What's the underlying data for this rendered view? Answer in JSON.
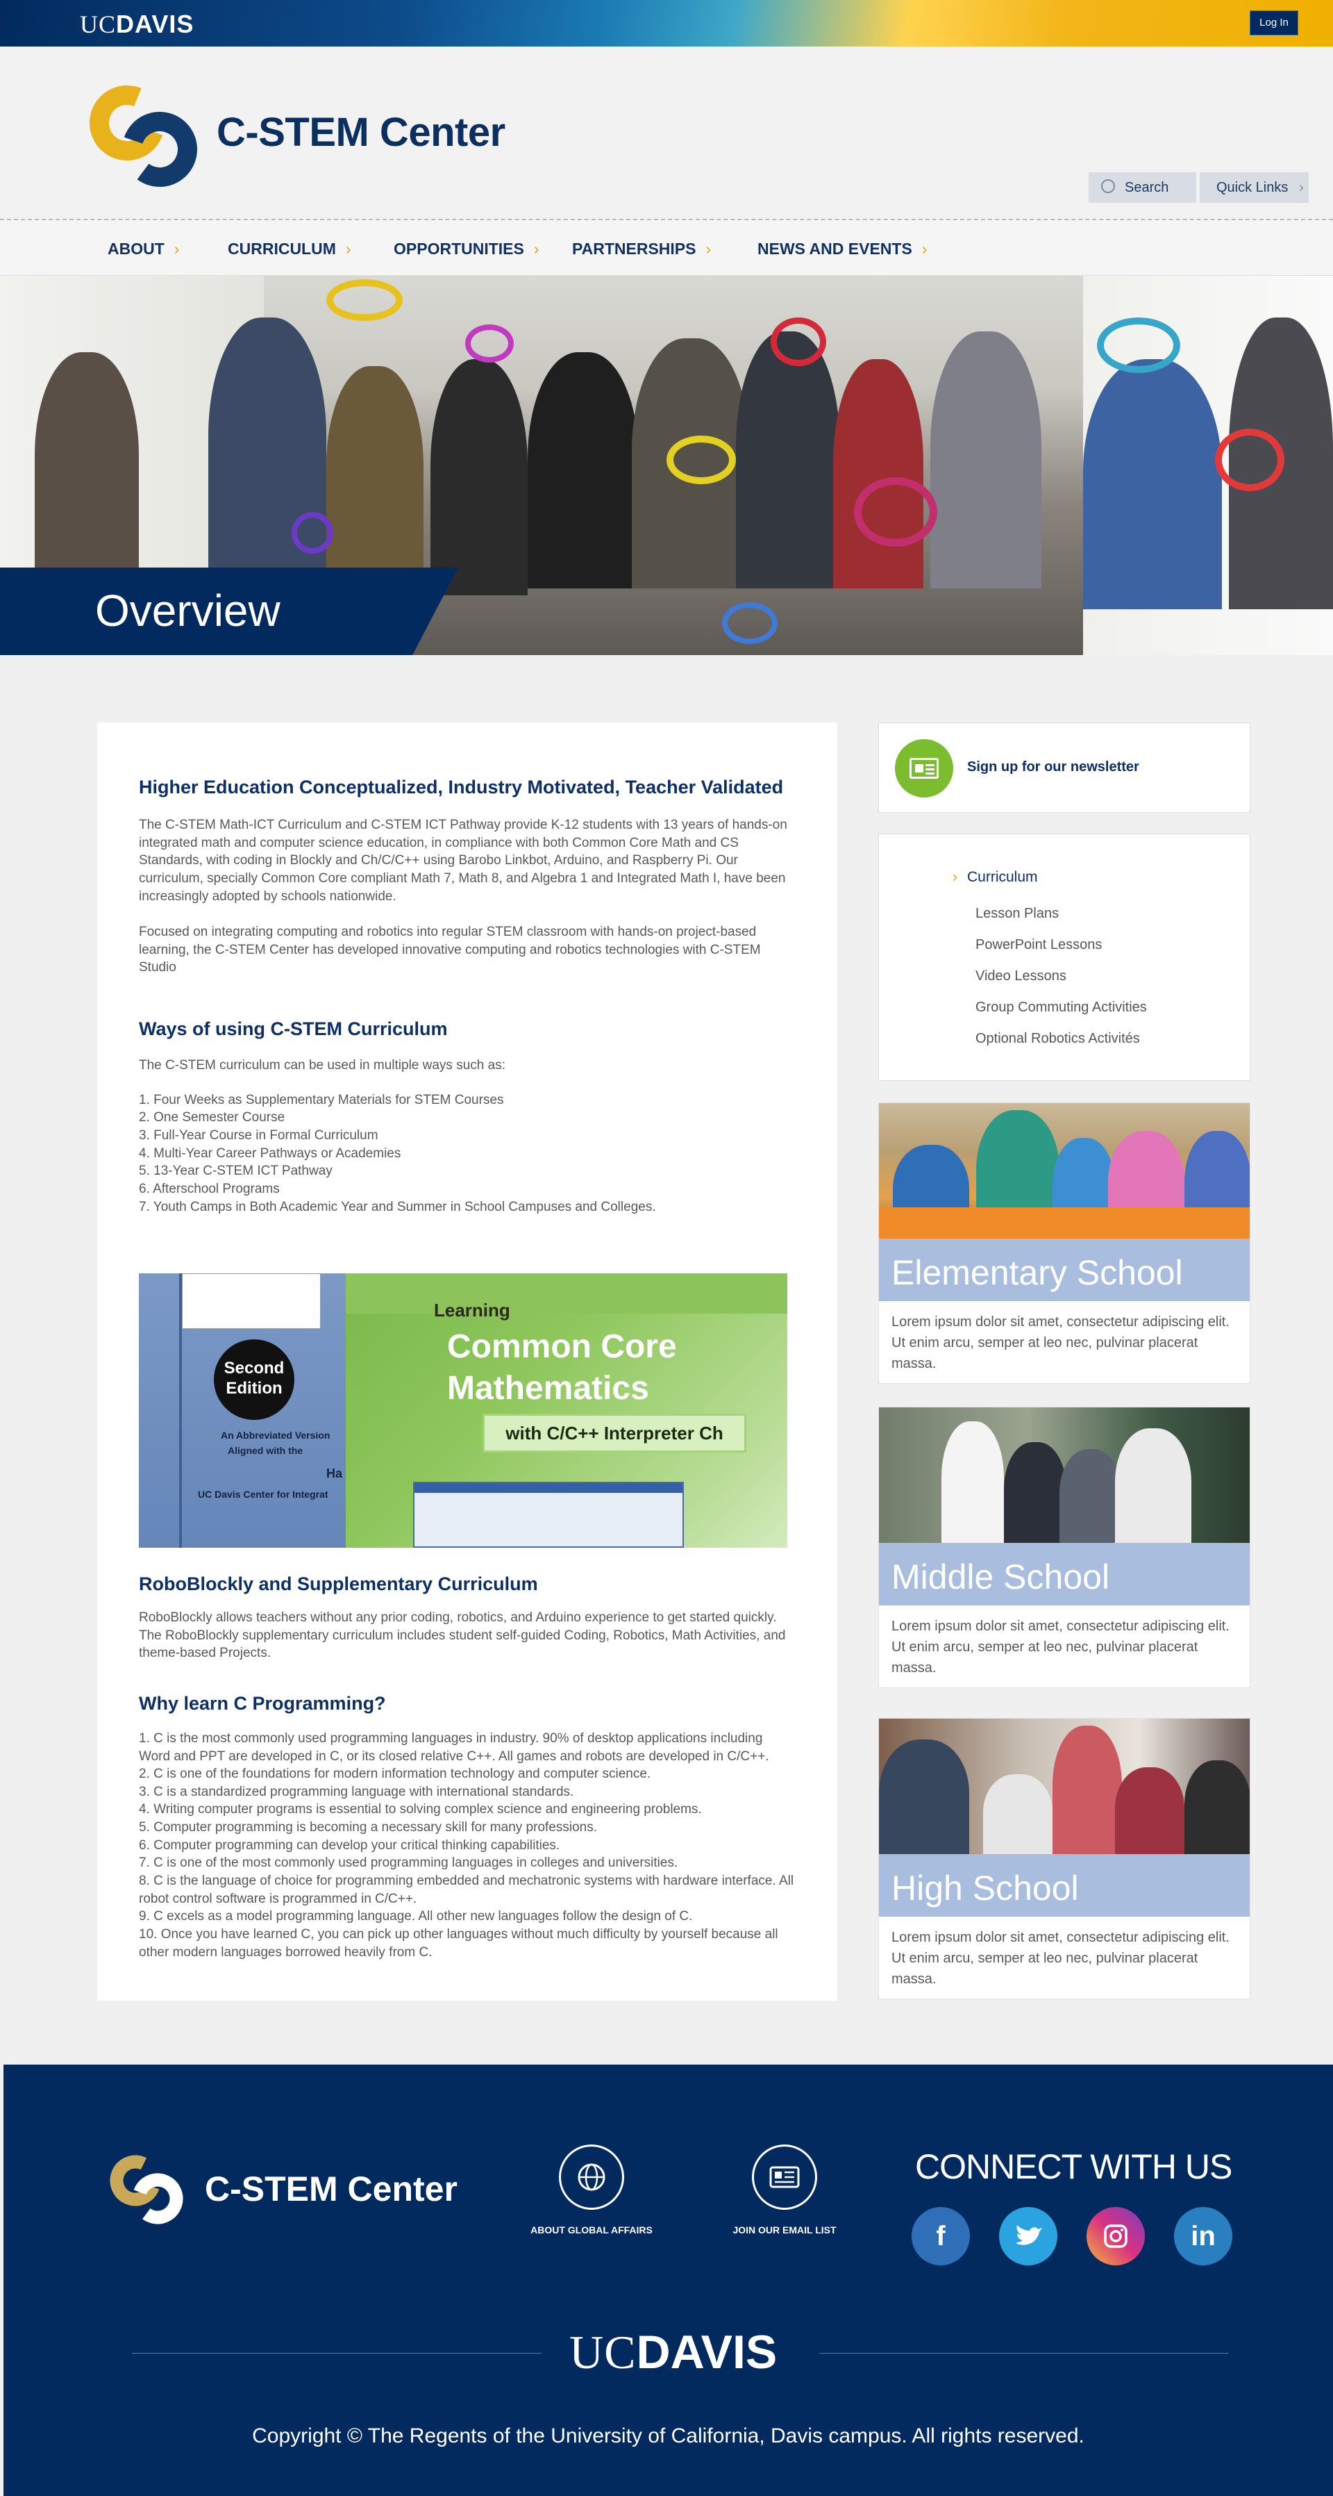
{
  "topbar": {
    "brand_light": "UC",
    "brand_bold": "DAVIS",
    "login": "Log In"
  },
  "header": {
    "site_title": "C-STEM Center",
    "search": "Search",
    "quick_links": "Quick Links"
  },
  "nav": [
    "ABOUT",
    "CURRICULUM",
    "OPPORTUNITIES",
    "PARTNERSHIPS",
    "NEWS AND EVENTS"
  ],
  "hero": {
    "title": "Overview"
  },
  "main": {
    "h1": "Higher Education Conceptualized, Industry Motivated, Teacher Validated",
    "p1": "The C-STEM Math-ICT Curriculum and C-STEM ICT Pathway provide K-12 students with  13 years of hands-on integrated math  and computer science education,  in compliance with both Common Core Math and CS Standards, with coding in Blockly and Ch/C/C++ using Barobo Linkbot, Arduino, and Raspberry Pi. Our curriculum, specially Common Core compliant  Math 7, Math 8, and Algebra 1 and Integrated Math I, have been increasingly adopted by schools nationwide.",
    "p2": "Focused on integrating computing and robotics into regular STEM classroom with hands-on project-based learning, the C-STEM Center has developed innovative computing and robotics technologies with C-STEM Studio",
    "h2": "Ways of using C-STEM Curriculum",
    "p3": "The C-STEM curriculum can be used in multiple ways such as:",
    "ways": [
      "1. Four Weeks as Supplementary Materials for STEM Courses",
      "2. One Semester Course",
      "3. Full-Year Course in Formal Curriculum",
      "4. Multi-Year Career Pathways or Academies",
      "5. 13-Year C-STEM ICT Pathway",
      "6. Afterschool Programs",
      "7. Youth Camps in Both Academic Year and Summer in School Campuses and Colleges."
    ],
    "book": {
      "second_edition": "Second Edition",
      "abbrev": "An Abbreviated Version",
      "aligned": "Aligned with the",
      "ha": "Ha",
      "ucd": "UC Davis Center for Integrat",
      "learning": "Learning",
      "common_core": "Common Core",
      "mathematics": "Mathematics",
      "interpreter": "with C/C++ Interpreter Ch"
    },
    "h3": "RoboBlockly and Supplementary Curriculum",
    "p4": "RoboBlockly allows teachers without any prior coding, robotics, and Arduino experience to get started quickly. The RoboBlockly supplementary curriculum includes student self-guided Coding, Robotics, Math Activities, and theme-based Projects.",
    "h4": "Why learn C Programming?",
    "reasons": [
      "1. C is the most commonly used programming languages in industry. 90% of desktop applications including Word and PPT are developed in C, or its closed relative C++.  All games and robots are developed in C/C++.",
      "2. C is one of the foundations for modern information technology and computer science.",
      "3. C is a standardized programming language with international standards.",
      "4. Writing computer programs is essential to solving complex science and engineering problems.",
      "5. Computer programming is becoming a necessary skill for many professions.",
      "6. Computer programming can develop your critical thinking capabilities.",
      "7. C is one of the most commonly used programming languages in colleges and universities.",
      "8. C is the language of choice for programming embedded and mechatronic systems with hardware interface. All robot control software is programmed in C/C++.",
      "9. C excels as a model programming language. All other new languages follow the design of C.",
      "10. Once you have learned C, you can pick up other languages without much difficulty by yourself because all other modern languages borrowed heavily from C."
    ]
  },
  "sidebar": {
    "newsletter": "Sign up for our newsletter",
    "submenu_head": "Curriculum",
    "submenu": [
      "Lesson Plans",
      "PowerPoint Lessons",
      "Video Lessons",
      "Group Commuting Activities",
      "Optional Robotics Activités"
    ],
    "cards": [
      {
        "title": "Elementary School",
        "desc": "Lorem ipsum dolor sit amet, consectetur adipiscing elit. Ut enim arcu, semper at leo nec, pulvinar placerat massa."
      },
      {
        "title": "Middle School",
        "desc": "Lorem ipsum dolor sit amet, consectetur adipiscing elit. Ut enim arcu, semper at leo nec, pulvinar placerat massa."
      },
      {
        "title": "High School",
        "desc": "Lorem ipsum dolor sit amet, consectetur adipiscing elit. Ut enim arcu, semper at leo nec, pulvinar placerat massa."
      }
    ]
  },
  "footer": {
    "title": "C-STEM Center",
    "global_affairs": "ABOUT GLOBAL AFFAIRS",
    "email_list": "JOIN OUR EMAIL LIST",
    "connect": "CONNECT WITH US",
    "social": {
      "facebook": "f",
      "linkedin": "in"
    },
    "uc_light": "UC",
    "uc_bold": "DAVIS",
    "copyright": "Copyright © The Regents of the University of California, Davis campus. All rights reserved."
  },
  "colors": {
    "navy": "#022a5e",
    "gold": "#e0a81e",
    "green": "#7bbd2f",
    "card_label": "#a9bedf"
  }
}
